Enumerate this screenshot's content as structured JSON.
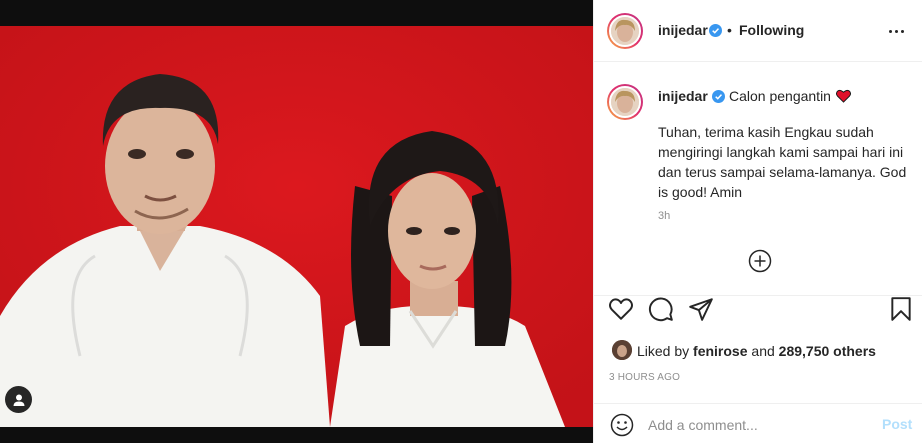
{
  "post": {
    "username": "inijedar",
    "verified": true,
    "separator": "•",
    "follow_status": "Following",
    "caption_title": "Calon pengantin",
    "caption_body": "Tuhan, terima kasih Engkau sudah mengiringi langkah kami sampai hari ini dan terus sampai selama-lamanya. God is good! Amin",
    "caption_time": "3h",
    "likes": {
      "prefix": "Liked by",
      "liker": "fenirose",
      "joiner": "and",
      "others": "289,750 others"
    },
    "timestamp": "3 HOURS AGO"
  },
  "comment": {
    "placeholder": "Add a comment...",
    "post_label": "Post"
  },
  "colors": {
    "photo_background": "#d8161c",
    "verified_badge": "#3897f0",
    "post_button_disabled": "#b2dffc",
    "heart_emoji": "#e0102b"
  },
  "icons": [
    "user-tag-icon",
    "verified-icon",
    "more-options-icon",
    "heart-emoji-icon",
    "load-more-icon",
    "like-icon",
    "comment-icon",
    "share-icon",
    "save-icon",
    "emoji-icon"
  ]
}
